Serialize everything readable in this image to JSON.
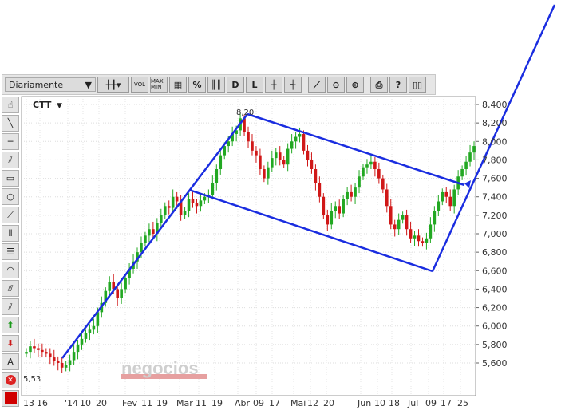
{
  "toolbar": {
    "period": "Diariamente",
    "buttons": [
      "VOL",
      "MAX MIN",
      "%",
      "D",
      "L"
    ]
  },
  "chart_data": {
    "type": "candlestick",
    "title": "CTT",
    "yticks": [
      "8,400",
      "8,200",
      "8,000",
      "7,800",
      "7,600",
      "7,400",
      "7,200",
      "7,000",
      "6,800",
      "6,600",
      "6,400",
      "6,200",
      "6,000",
      "5,800",
      "5,600"
    ],
    "ylim": [
      5.3,
      8.45
    ],
    "xticks": [
      "13",
      "16",
      "'14",
      "10",
      "20",
      "Fev",
      "11",
      "19",
      "Mar",
      "11",
      "19",
      "Abr",
      "09",
      "17",
      "Mai",
      "12",
      "20",
      "Jun",
      "10",
      "18",
      "Jul",
      "09",
      "17",
      "25"
    ],
    "annotations": [
      {
        "text": "8,20",
        "label": "high"
      },
      {
        "text": "5,53",
        "label": "low"
      }
    ],
    "close": [
      5.72,
      5.78,
      5.76,
      5.74,
      5.72,
      5.7,
      5.66,
      5.62,
      5.6,
      5.55,
      5.58,
      5.63,
      5.72,
      5.8,
      5.86,
      5.92,
      5.96,
      6.0,
      6.15,
      6.25,
      6.38,
      6.48,
      6.4,
      6.3,
      6.4,
      6.52,
      6.62,
      6.7,
      6.8,
      6.9,
      6.98,
      7.05,
      7.0,
      7.12,
      7.2,
      7.3,
      7.28,
      7.4,
      7.35,
      7.2,
      7.25,
      7.38,
      7.33,
      7.3,
      7.36,
      7.4,
      7.42,
      7.55,
      7.7,
      7.85,
      7.95,
      8.0,
      8.08,
      8.12,
      8.25,
      8.1,
      8.0,
      7.9,
      7.85,
      7.7,
      7.6,
      7.72,
      7.82,
      7.88,
      7.8,
      7.75,
      7.92,
      8.0,
      8.05,
      8.08,
      7.9,
      7.8,
      7.7,
      7.55,
      7.4,
      7.2,
      7.1,
      7.25,
      7.3,
      7.22,
      7.38,
      7.45,
      7.4,
      7.5,
      7.62,
      7.72,
      7.75,
      7.78,
      7.7,
      7.6,
      7.48,
      7.3,
      7.1,
      7.05,
      7.15,
      7.2,
      7.05,
      6.95,
      6.98,
      6.92,
      6.9,
      6.95,
      7.1,
      7.25,
      7.35,
      7.45,
      7.4,
      7.3,
      7.48,
      7.62,
      7.7,
      7.78,
      7.88,
      7.95
    ]
  },
  "watermark": {
    "text": "negocios"
  }
}
